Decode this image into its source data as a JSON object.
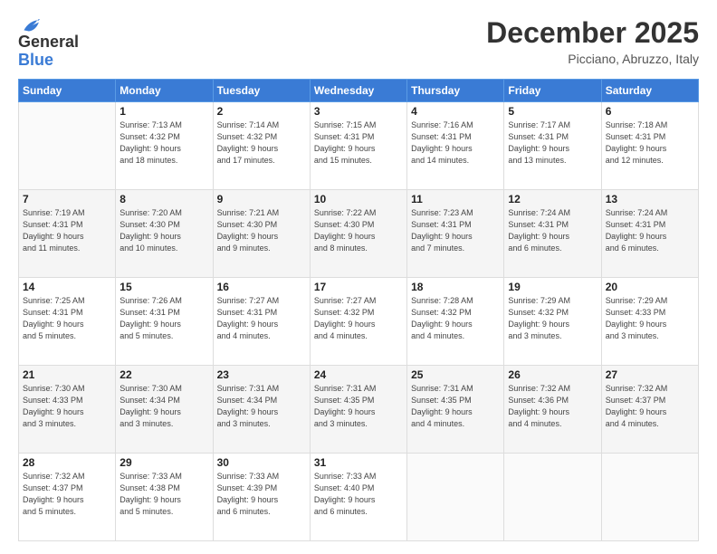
{
  "header": {
    "logo_line1": "General",
    "logo_line2": "Blue",
    "month": "December 2025",
    "location": "Picciano, Abruzzo, Italy"
  },
  "weekdays": [
    "Sunday",
    "Monday",
    "Tuesday",
    "Wednesday",
    "Thursday",
    "Friday",
    "Saturday"
  ],
  "weeks": [
    [
      {
        "day": "",
        "info": ""
      },
      {
        "day": "1",
        "info": "Sunrise: 7:13 AM\nSunset: 4:32 PM\nDaylight: 9 hours\nand 18 minutes."
      },
      {
        "day": "2",
        "info": "Sunrise: 7:14 AM\nSunset: 4:32 PM\nDaylight: 9 hours\nand 17 minutes."
      },
      {
        "day": "3",
        "info": "Sunrise: 7:15 AM\nSunset: 4:31 PM\nDaylight: 9 hours\nand 15 minutes."
      },
      {
        "day": "4",
        "info": "Sunrise: 7:16 AM\nSunset: 4:31 PM\nDaylight: 9 hours\nand 14 minutes."
      },
      {
        "day": "5",
        "info": "Sunrise: 7:17 AM\nSunset: 4:31 PM\nDaylight: 9 hours\nand 13 minutes."
      },
      {
        "day": "6",
        "info": "Sunrise: 7:18 AM\nSunset: 4:31 PM\nDaylight: 9 hours\nand 12 minutes."
      }
    ],
    [
      {
        "day": "7",
        "info": "Sunrise: 7:19 AM\nSunset: 4:31 PM\nDaylight: 9 hours\nand 11 minutes."
      },
      {
        "day": "8",
        "info": "Sunrise: 7:20 AM\nSunset: 4:30 PM\nDaylight: 9 hours\nand 10 minutes."
      },
      {
        "day": "9",
        "info": "Sunrise: 7:21 AM\nSunset: 4:30 PM\nDaylight: 9 hours\nand 9 minutes."
      },
      {
        "day": "10",
        "info": "Sunrise: 7:22 AM\nSunset: 4:30 PM\nDaylight: 9 hours\nand 8 minutes."
      },
      {
        "day": "11",
        "info": "Sunrise: 7:23 AM\nSunset: 4:31 PM\nDaylight: 9 hours\nand 7 minutes."
      },
      {
        "day": "12",
        "info": "Sunrise: 7:24 AM\nSunset: 4:31 PM\nDaylight: 9 hours\nand 6 minutes."
      },
      {
        "day": "13",
        "info": "Sunrise: 7:24 AM\nSunset: 4:31 PM\nDaylight: 9 hours\nand 6 minutes."
      }
    ],
    [
      {
        "day": "14",
        "info": "Sunrise: 7:25 AM\nSunset: 4:31 PM\nDaylight: 9 hours\nand 5 minutes."
      },
      {
        "day": "15",
        "info": "Sunrise: 7:26 AM\nSunset: 4:31 PM\nDaylight: 9 hours\nand 5 minutes."
      },
      {
        "day": "16",
        "info": "Sunrise: 7:27 AM\nSunset: 4:31 PM\nDaylight: 9 hours\nand 4 minutes."
      },
      {
        "day": "17",
        "info": "Sunrise: 7:27 AM\nSunset: 4:32 PM\nDaylight: 9 hours\nand 4 minutes."
      },
      {
        "day": "18",
        "info": "Sunrise: 7:28 AM\nSunset: 4:32 PM\nDaylight: 9 hours\nand 4 minutes."
      },
      {
        "day": "19",
        "info": "Sunrise: 7:29 AM\nSunset: 4:32 PM\nDaylight: 9 hours\nand 3 minutes."
      },
      {
        "day": "20",
        "info": "Sunrise: 7:29 AM\nSunset: 4:33 PM\nDaylight: 9 hours\nand 3 minutes."
      }
    ],
    [
      {
        "day": "21",
        "info": "Sunrise: 7:30 AM\nSunset: 4:33 PM\nDaylight: 9 hours\nand 3 minutes."
      },
      {
        "day": "22",
        "info": "Sunrise: 7:30 AM\nSunset: 4:34 PM\nDaylight: 9 hours\nand 3 minutes."
      },
      {
        "day": "23",
        "info": "Sunrise: 7:31 AM\nSunset: 4:34 PM\nDaylight: 9 hours\nand 3 minutes."
      },
      {
        "day": "24",
        "info": "Sunrise: 7:31 AM\nSunset: 4:35 PM\nDaylight: 9 hours\nand 3 minutes."
      },
      {
        "day": "25",
        "info": "Sunrise: 7:31 AM\nSunset: 4:35 PM\nDaylight: 9 hours\nand 4 minutes."
      },
      {
        "day": "26",
        "info": "Sunrise: 7:32 AM\nSunset: 4:36 PM\nDaylight: 9 hours\nand 4 minutes."
      },
      {
        "day": "27",
        "info": "Sunrise: 7:32 AM\nSunset: 4:37 PM\nDaylight: 9 hours\nand 4 minutes."
      }
    ],
    [
      {
        "day": "28",
        "info": "Sunrise: 7:32 AM\nSunset: 4:37 PM\nDaylight: 9 hours\nand 5 minutes."
      },
      {
        "day": "29",
        "info": "Sunrise: 7:33 AM\nSunset: 4:38 PM\nDaylight: 9 hours\nand 5 minutes."
      },
      {
        "day": "30",
        "info": "Sunrise: 7:33 AM\nSunset: 4:39 PM\nDaylight: 9 hours\nand 6 minutes."
      },
      {
        "day": "31",
        "info": "Sunrise: 7:33 AM\nSunset: 4:40 PM\nDaylight: 9 hours\nand 6 minutes."
      },
      {
        "day": "",
        "info": ""
      },
      {
        "day": "",
        "info": ""
      },
      {
        "day": "",
        "info": ""
      }
    ]
  ]
}
